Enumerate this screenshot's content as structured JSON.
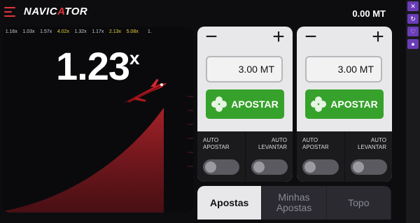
{
  "header": {
    "logo_text_a": "NAVIC",
    "logo_text_b": "A",
    "logo_text_c": "TOR",
    "balance": "0.00 MT"
  },
  "side_tools": [
    "close-icon",
    "refresh-icon",
    "heart-icon",
    "circle-icon"
  ],
  "history": [
    {
      "value": "1.16x",
      "color": "#c9c9d8"
    },
    {
      "value": "1.03x",
      "color": "#c9c9d8"
    },
    {
      "value": "1.57x",
      "color": "#c9c9d8"
    },
    {
      "value": "4.02x",
      "color": "#e6d23a"
    },
    {
      "value": "1.32x",
      "color": "#c9c9d8"
    },
    {
      "value": "1.17x",
      "color": "#c9c9d8"
    },
    {
      "value": "2.13x",
      "color": "#e6d23a"
    },
    {
      "value": "5.08x",
      "color": "#e6d23a"
    },
    {
      "value": "1.",
      "color": "#c9c9d8"
    }
  ],
  "game": {
    "multiplier": "1.23",
    "multiplier_suffix": "x"
  },
  "bet_panels": [
    {
      "minus": "−",
      "plus": "+",
      "amount": "3.00 MT",
      "place_label": "APOSTAR",
      "auto_bet_label_1": "AUTO",
      "auto_bet_label_2": "APOSTAR",
      "auto_cash_label_1": "AUTO",
      "auto_cash_label_2": "LEVANTAR"
    },
    {
      "minus": "−",
      "plus": "+",
      "amount": "3.00 MT",
      "place_label": "APOSTAR",
      "auto_bet_label_1": "AUTO",
      "auto_bet_label_2": "APOSTAR",
      "auto_cash_label_1": "AUTO",
      "auto_cash_label_2": "LEVANTAR"
    }
  ],
  "tabs": [
    {
      "line1": "Apostas",
      "line2": "",
      "active": true
    },
    {
      "line1": "Minhas",
      "line2": "Apostas",
      "active": false
    },
    {
      "line1": "Topo",
      "line2": "",
      "active": false
    }
  ],
  "colors": {
    "accent": "#e0353b",
    "bet_button": "#36a22c",
    "panel": "#e8e8ea"
  }
}
